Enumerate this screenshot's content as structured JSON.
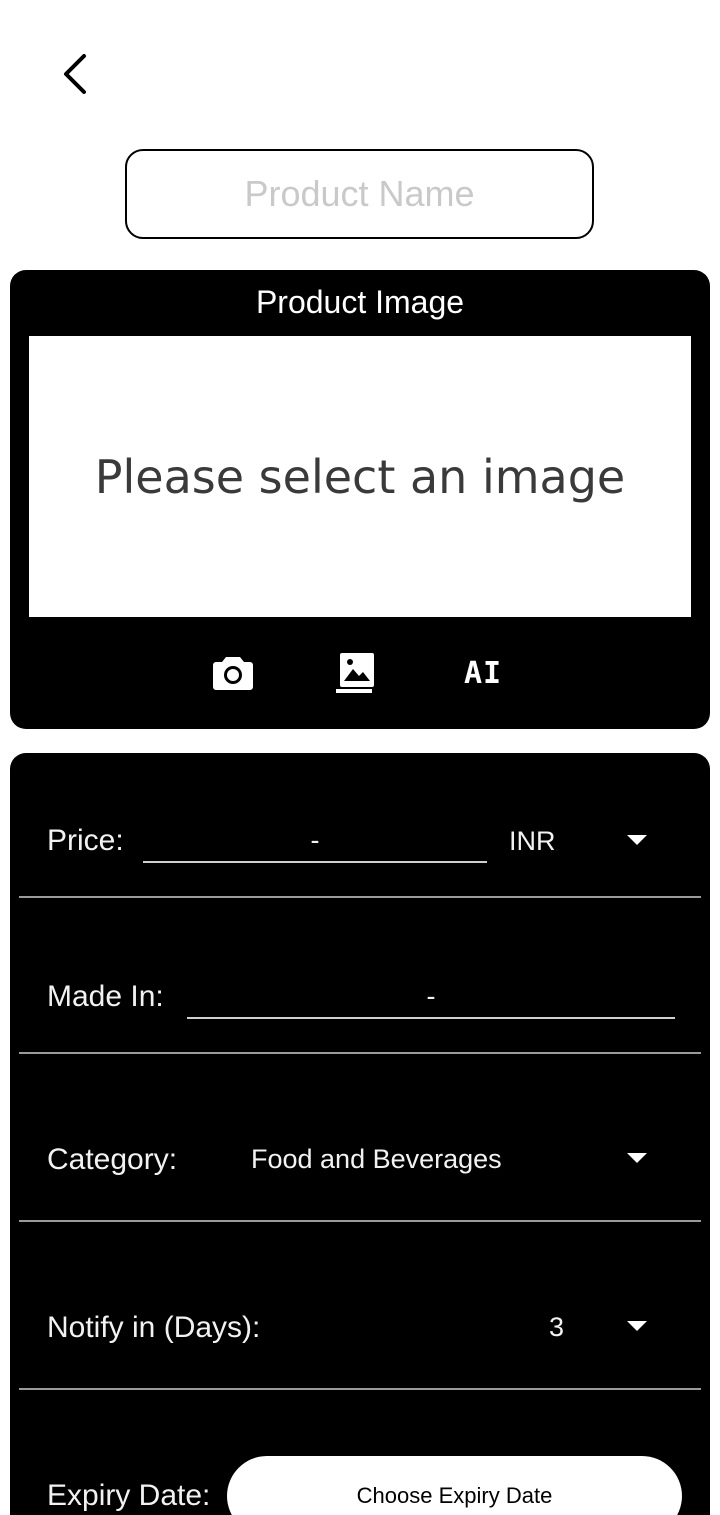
{
  "header": {
    "back_icon": "chevron-left-icon"
  },
  "product_name": {
    "placeholder": "Product Name",
    "value": ""
  },
  "image_section": {
    "title": "Product Image",
    "placeholder_text": "Please select an image",
    "actions": [
      {
        "icon": "camera-icon"
      },
      {
        "icon": "photo-library-icon"
      },
      {
        "icon": "ai-icon",
        "label": "AI"
      }
    ]
  },
  "details": {
    "price": {
      "label": "Price:",
      "value": "-",
      "currency": "INR"
    },
    "made_in": {
      "label": "Made In:",
      "value": "-"
    },
    "category": {
      "label": "Category:",
      "value": "Food and Beverages"
    },
    "notify": {
      "label": "Notify in (Days):",
      "value": "3"
    },
    "expiry": {
      "label": "Expiry Date:",
      "button_label": "Choose Expiry Date"
    }
  },
  "colors": {
    "card_background": "#000000",
    "page_background": "#ffffff",
    "placeholder": "#c9c9c9",
    "divider": "#9a9a9a"
  }
}
